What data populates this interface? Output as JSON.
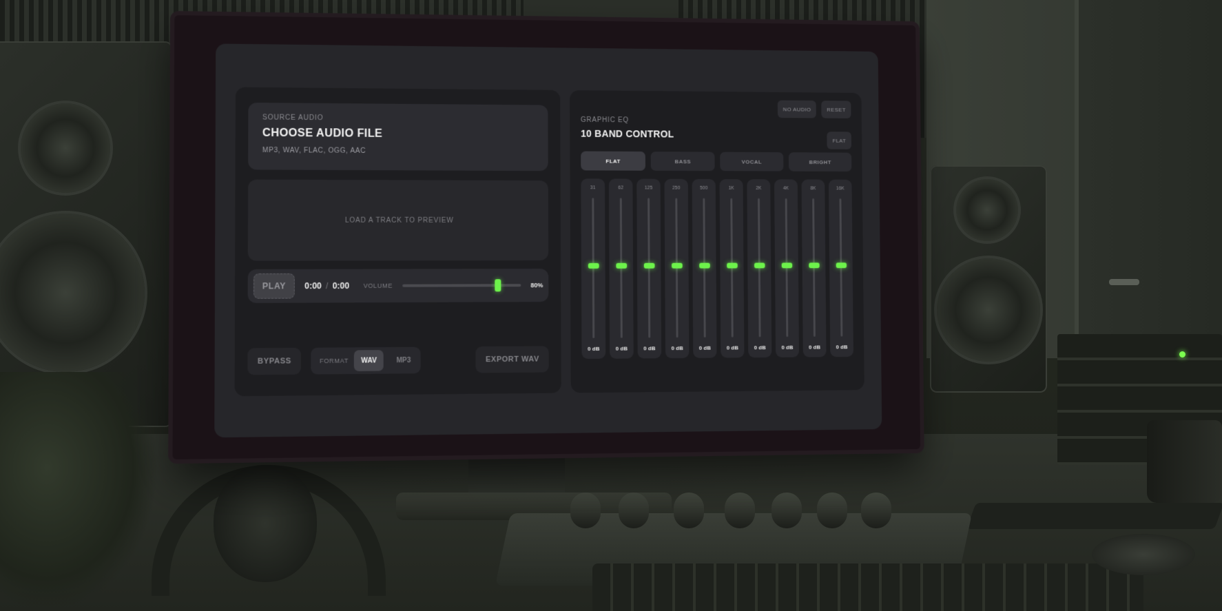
{
  "source": {
    "eyebrow": "SOURCE AUDIO",
    "title": "CHOOSE AUDIO FILE",
    "formats": "MP3, WAV, FLAC, OGG, AAC"
  },
  "preview": {
    "placeholder": "LOAD A TRACK TO PREVIEW"
  },
  "transport": {
    "play_label": "PLAY",
    "current_time": "0:00",
    "separator": "/",
    "total_time": "0:00",
    "volume_label": "VOLUME",
    "volume_value": "80%",
    "volume_fraction": 0.8
  },
  "actions": {
    "bypass_label": "BYPASS",
    "format_label": "FORMAT",
    "format_options": [
      "WAV",
      "MP3"
    ],
    "format_selected": "WAV",
    "export_label": "EXPORT WAV"
  },
  "eq": {
    "eyebrow": "GRAPHIC EQ",
    "title": "10 BAND CONTROL",
    "no_audio_label": "NO AUDIO",
    "reset_label": "RESET",
    "flat_mini_label": "FLAT",
    "presets": [
      "FLAT",
      "BASS",
      "VOCAL",
      "BRIGHT"
    ],
    "active_preset": "FLAT",
    "bands": [
      {
        "freq": "31",
        "gain": "0 dB"
      },
      {
        "freq": "62",
        "gain": "0 dB"
      },
      {
        "freq": "125",
        "gain": "0 dB"
      },
      {
        "freq": "250",
        "gain": "0 dB"
      },
      {
        "freq": "500",
        "gain": "0 dB"
      },
      {
        "freq": "1K",
        "gain": "0 dB"
      },
      {
        "freq": "2K",
        "gain": "0 dB"
      },
      {
        "freq": "4K",
        "gain": "0 dB"
      },
      {
        "freq": "8K",
        "gain": "0 dB"
      },
      {
        "freq": "16K",
        "gain": "0 dB"
      }
    ]
  },
  "colors": {
    "accent": "#6df24b",
    "panel": "#1d1d20",
    "card": "#2c2c31"
  }
}
